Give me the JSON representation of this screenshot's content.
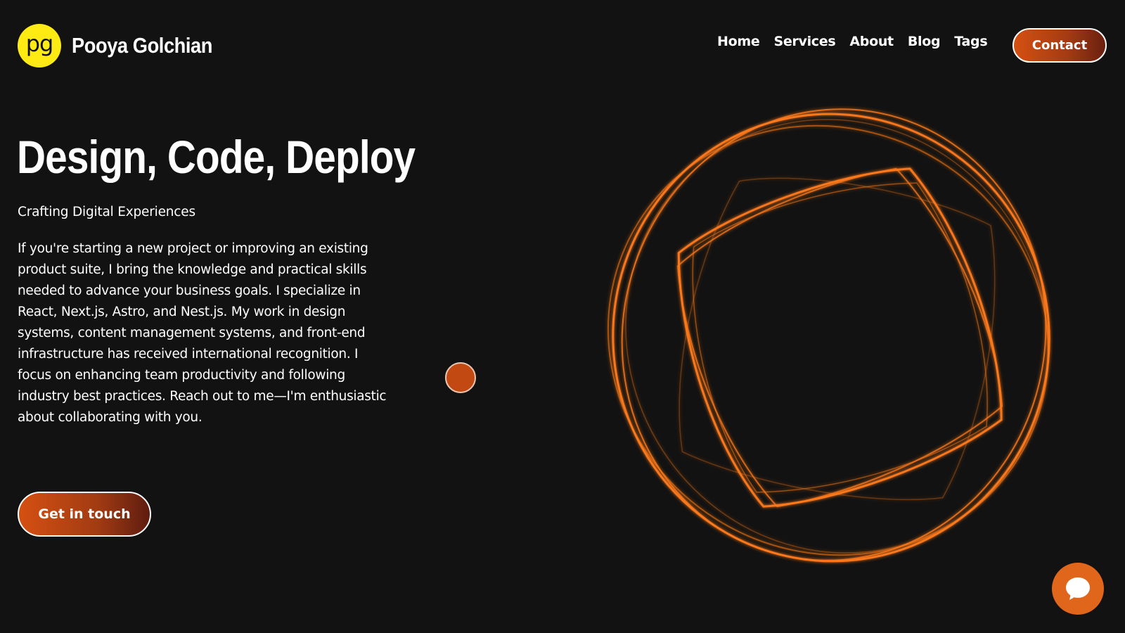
{
  "header": {
    "logo_text": "pg",
    "brand_name": "Pooya Golchian",
    "nav": [
      "Home",
      "Services",
      "About",
      "Blog",
      "Tags"
    ],
    "contact_label": "Contact"
  },
  "hero": {
    "title": "Design, Code, Deploy",
    "subtitle": "Crafting Digital Experiences",
    "body": "If you're starting a new project or improving an existing product suite, I bring the knowledge and practical skills needed to advance your business goals. I specialize in React, Next.js, Astro, and Nest.js. My work in design systems, content management systems, and front-end infrastructure has received international recognition. I focus on enhancing team productivity and following industry best practices. Reach out to me—I'm enthusiastic about collaborating with you.",
    "cta_label": "Get in touch"
  },
  "colors": {
    "background": "#121212",
    "accent": "#d55012",
    "logo_yellow": "#ffeb14",
    "ring_orange": "#ff7a1a"
  },
  "icons": {
    "chat": "chat-bubble-icon",
    "decor": "orbital-rings-art"
  }
}
